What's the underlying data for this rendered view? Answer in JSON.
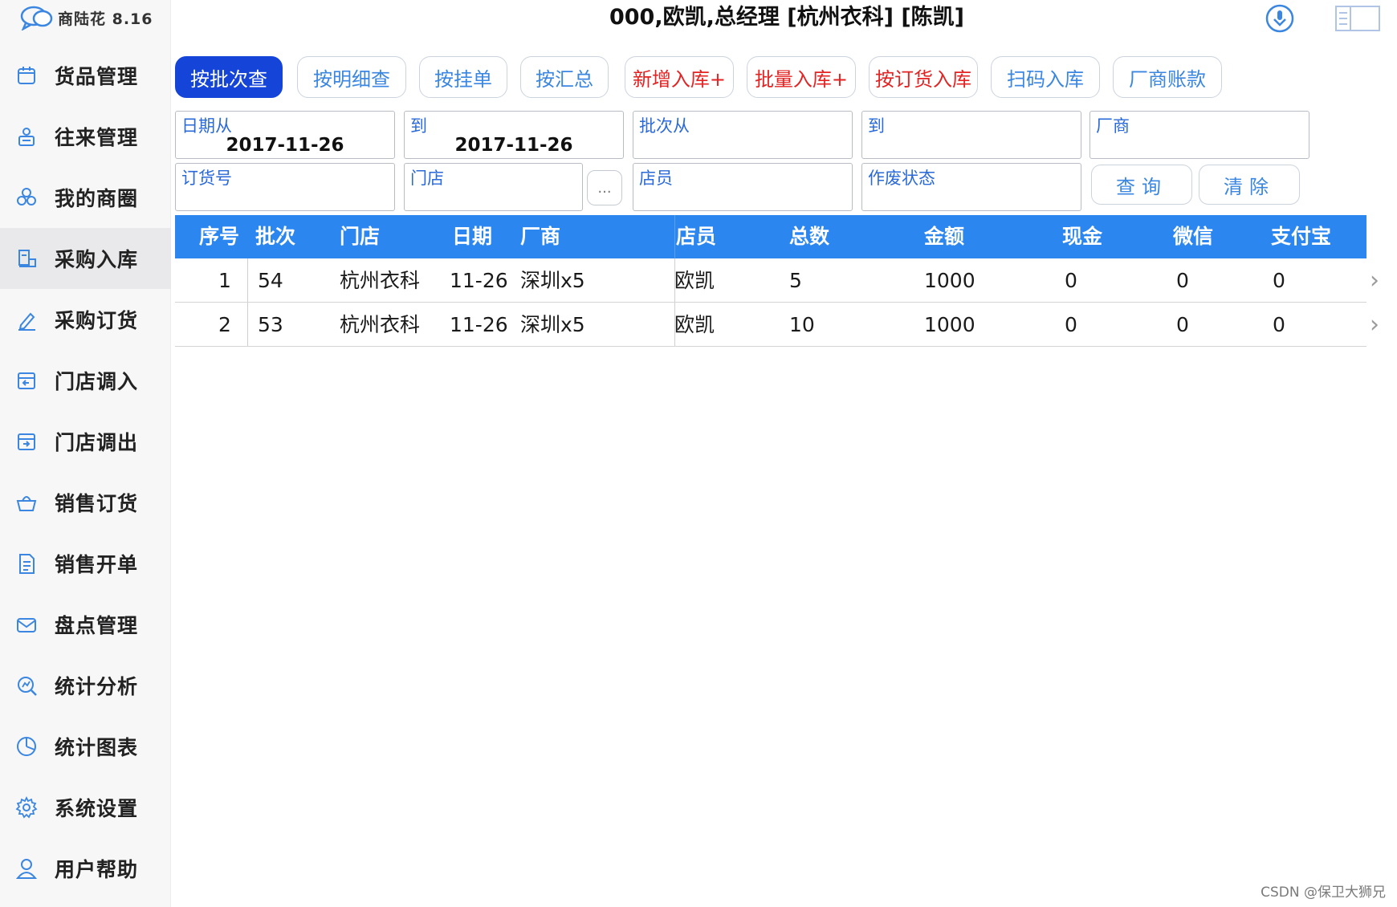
{
  "app": {
    "name": "商陆花 8.16"
  },
  "header": {
    "title": "000,欧凯,总经理 [杭州衣科] [陈凯]"
  },
  "sidebar": {
    "items": [
      {
        "label": "货品管理",
        "icon": "box-icon"
      },
      {
        "label": "往来管理",
        "icon": "contact-icon"
      },
      {
        "label": "我的商圈",
        "icon": "circles-icon"
      },
      {
        "label": "采购入库",
        "icon": "purchase-inbound-icon",
        "active": true
      },
      {
        "label": "采购订货",
        "icon": "pen-icon"
      },
      {
        "label": "门店调入",
        "icon": "store-in-icon"
      },
      {
        "label": "门店调出",
        "icon": "store-out-icon"
      },
      {
        "label": "销售订货",
        "icon": "basket-icon"
      },
      {
        "label": "销售开单",
        "icon": "document-icon"
      },
      {
        "label": "盘点管理",
        "icon": "envelope-icon"
      },
      {
        "label": "统计分析",
        "icon": "analysis-icon"
      },
      {
        "label": "统计图表",
        "icon": "pie-chart-icon"
      },
      {
        "label": "系统设置",
        "icon": "gear-icon"
      },
      {
        "label": "用户帮助",
        "icon": "user-icon"
      }
    ]
  },
  "toolbar": {
    "buttons": [
      {
        "label": "按批次查",
        "style": "primary"
      },
      {
        "label": "按明细查",
        "style": "normal"
      },
      {
        "label": "按挂单",
        "style": "normal"
      },
      {
        "label": "按汇总",
        "style": "normal"
      },
      {
        "label": "新增入库+",
        "style": "red"
      },
      {
        "label": "批量入库+",
        "style": "red"
      },
      {
        "label": "按订货入库",
        "style": "red"
      },
      {
        "label": "扫码入库",
        "style": "normal"
      },
      {
        "label": "厂商账款",
        "style": "normal"
      }
    ]
  },
  "filters": {
    "date_from": {
      "label": "日期从",
      "value": "2017-11-26"
    },
    "date_to": {
      "label": "到",
      "value": "2017-11-26"
    },
    "batch_from": {
      "label": "批次从",
      "value": ""
    },
    "batch_to": {
      "label": "到",
      "value": ""
    },
    "vendor": {
      "label": "厂商",
      "value": ""
    },
    "order_no": {
      "label": "订货号",
      "value": ""
    },
    "store": {
      "label": "门店",
      "value": ""
    },
    "store_picker": "...",
    "clerk": {
      "label": "店员",
      "value": ""
    },
    "void_status": {
      "label": "作废状态",
      "value": ""
    },
    "query_label": "查询",
    "clear_label": "清除"
  },
  "table": {
    "columns": [
      "序号",
      "批次",
      "门店",
      "日期",
      "厂商",
      "店员",
      "总数",
      "金额",
      "现金",
      "微信",
      "支付宝"
    ],
    "rows": [
      [
        "1",
        "54",
        "杭州衣科",
        "11-26",
        "深圳x5",
        "欧凯",
        "5",
        "1000",
        "0",
        "0",
        "0"
      ],
      [
        "2",
        "53",
        "杭州衣科",
        "11-26",
        "深圳x5",
        "欧凯",
        "10",
        "1000",
        "0",
        "0",
        "0"
      ]
    ]
  },
  "colors": {
    "accent": "#2b86f0",
    "primary_button": "#1544d9",
    "danger_text": "#e32222",
    "link_text": "#3a86e0"
  },
  "watermark": "CSDN @保卫大狮兄"
}
